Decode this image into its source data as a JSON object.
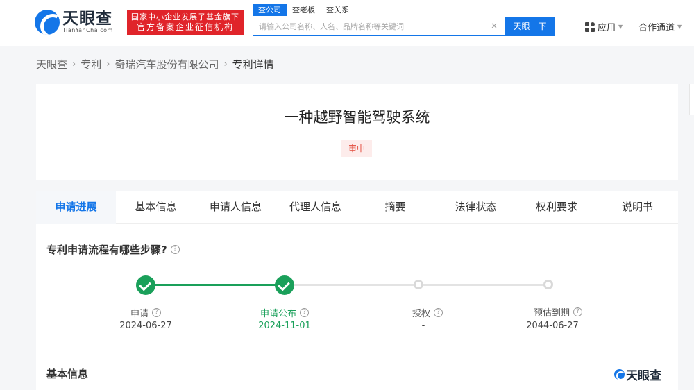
{
  "header": {
    "logo_cn": "天眼查",
    "logo_en": "TianYanCha.com",
    "badge_line1": "国家中小企业发展子基金旗下",
    "badge_line2": "官方备案企业征信机构",
    "search_tabs": [
      "查公司",
      "查老板",
      "查关系"
    ],
    "search_placeholder": "请输入公司名称、人名、品牌名称等关键词",
    "clear_glyph": "×",
    "search_button": "天眼一下",
    "apps_label": "应用",
    "partner_label": "合作通道",
    "caret": "▼"
  },
  "breadcrumb": {
    "items": [
      "天眼查",
      "专利",
      "奇瑞汽车股份有限公司",
      "专利详情"
    ],
    "separator": "›"
  },
  "patent": {
    "title": "一种越野智能驾驶系统",
    "status": "审中"
  },
  "tabs": [
    "申请进展",
    "基本信息",
    "申请人信息",
    "代理人信息",
    "摘要",
    "法律状态",
    "权利要求",
    "说明书"
  ],
  "progress": {
    "heading": "专利申请流程有哪些步骤?",
    "help_glyph": "?",
    "steps": [
      {
        "label": "申请",
        "date": "2024-06-27",
        "done": true
      },
      {
        "label": "申请公布",
        "date": "2024-11-01",
        "done": true
      },
      {
        "label": "授权",
        "date": "-",
        "done": false
      },
      {
        "label": "预估到期",
        "date": "2044-06-27",
        "done": false
      }
    ]
  },
  "basic_info_heading": "基本信息",
  "watermark": "天眼查",
  "colors": {
    "brand_blue": "#1476e8",
    "success_green": "#1aa05a",
    "status_red": "#e24a3b",
    "badge_red": "#e0242a"
  }
}
